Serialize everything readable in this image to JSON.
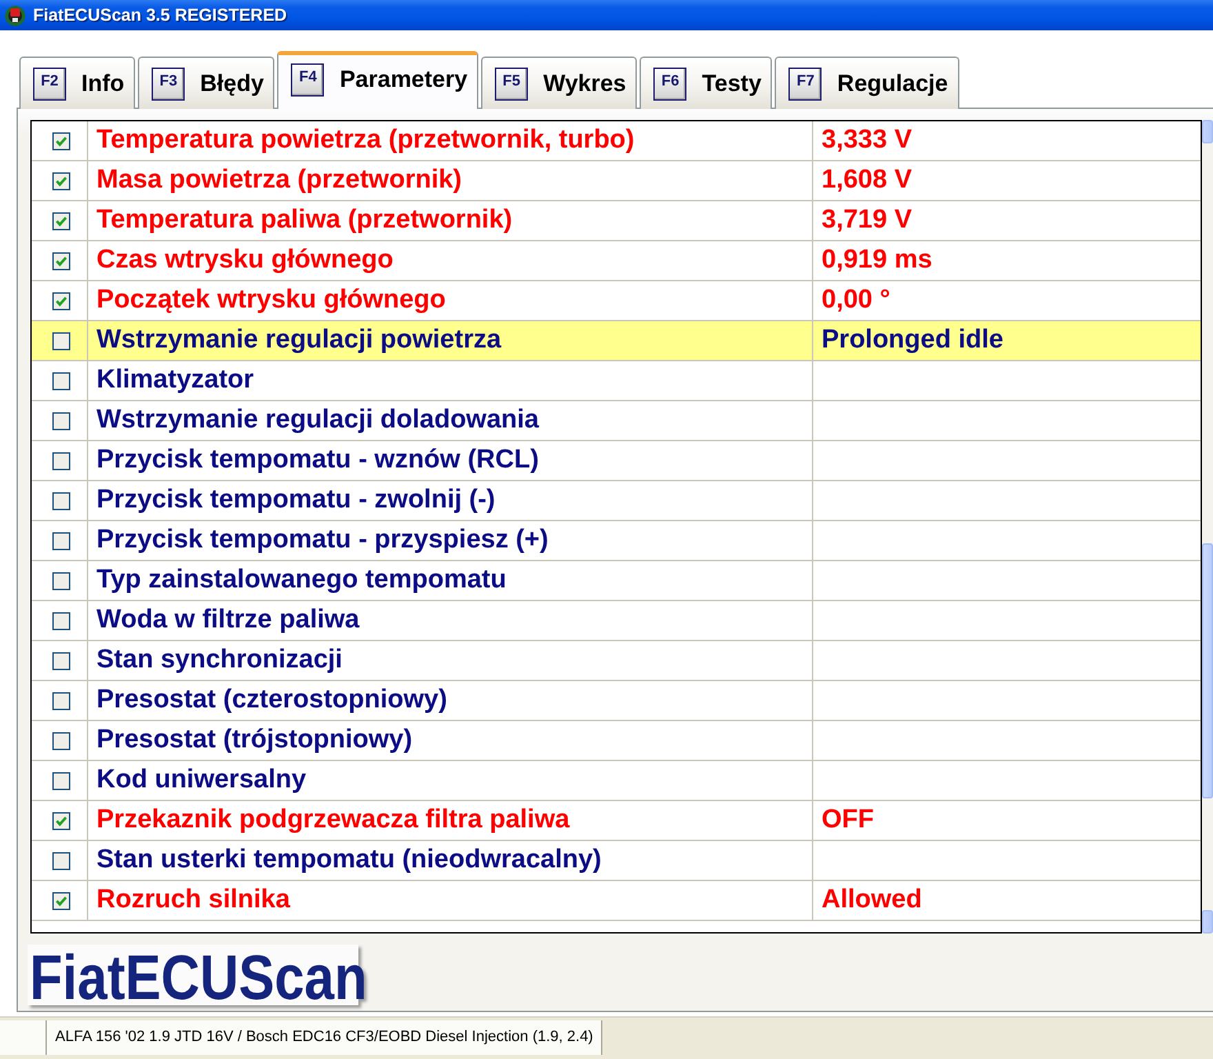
{
  "window": {
    "title": "FiatECUScan 3.5 REGISTERED"
  },
  "tabs": [
    {
      "key": "F2",
      "label": "Info",
      "selected": false
    },
    {
      "key": "F3",
      "label": "Błędy",
      "selected": false
    },
    {
      "key": "F4",
      "label": "Parametery",
      "selected": true
    },
    {
      "key": "F5",
      "label": "Wykres",
      "selected": false
    },
    {
      "key": "F6",
      "label": "Testy",
      "selected": false
    },
    {
      "key": "F7",
      "label": "Regulacje",
      "selected": false
    }
  ],
  "parameters": [
    {
      "name": "Temperatura powietrza (przetwornik, turbo)",
      "value": "3,333 V",
      "checked": true,
      "selected": false
    },
    {
      "name": "Masa powietrza (przetwornik)",
      "value": "1,608 V",
      "checked": true,
      "selected": false
    },
    {
      "name": "Temperatura paliwa (przetwornik)",
      "value": "3,719 V",
      "checked": true,
      "selected": false
    },
    {
      "name": "Czas wtrysku głównego",
      "value": "0,919 ms",
      "checked": true,
      "selected": false
    },
    {
      "name": "Początek wtrysku głównego",
      "value": "0,00 °",
      "checked": true,
      "selected": false
    },
    {
      "name": "Wstrzymanie regulacji powietrza",
      "value": "Prolonged idle",
      "checked": false,
      "selected": true
    },
    {
      "name": "Klimatyzator",
      "checked": false,
      "selected": false
    },
    {
      "name": "Wstrzymanie regulacji doladowania",
      "checked": false,
      "selected": false
    },
    {
      "name": "Przycisk tempomatu - wznów (RCL)",
      "checked": false,
      "selected": false
    },
    {
      "name": "Przycisk tempomatu - zwolnij (-)",
      "checked": false,
      "selected": false
    },
    {
      "name": "Przycisk tempomatu - przyspiesz (+)",
      "checked": false,
      "selected": false
    },
    {
      "name": "Typ zainstalowanego tempomatu",
      "checked": false,
      "selected": false
    },
    {
      "name": "Woda w filtrze paliwa",
      "checked": false,
      "selected": false
    },
    {
      "name": "Stan synchronizacji",
      "checked": false,
      "selected": false
    },
    {
      "name": "Presostat (czterostopniowy)",
      "checked": false,
      "selected": false
    },
    {
      "name": "Presostat (trójstopniowy)",
      "checked": false,
      "selected": false
    },
    {
      "name": "Kod uniwersalny",
      "checked": false,
      "selected": false
    },
    {
      "name": "Przekaznik podgrzewacza filtra paliwa",
      "value": "OFF",
      "checked": true,
      "selected": false
    },
    {
      "name": "Stan usterki tempomatu (nieodwracalny)",
      "checked": false,
      "selected": false
    },
    {
      "name": "Rozruch silnika",
      "value": "Allowed",
      "checked": true,
      "selected": false
    }
  ],
  "logo": "FiatECUScan",
  "status_bar": {
    "vehicle": "ALFA 156 '02 1.9 JTD 16V / Bosch EDC16 CF3/EOBD Diesel Injection (1.9, 2.4)"
  }
}
